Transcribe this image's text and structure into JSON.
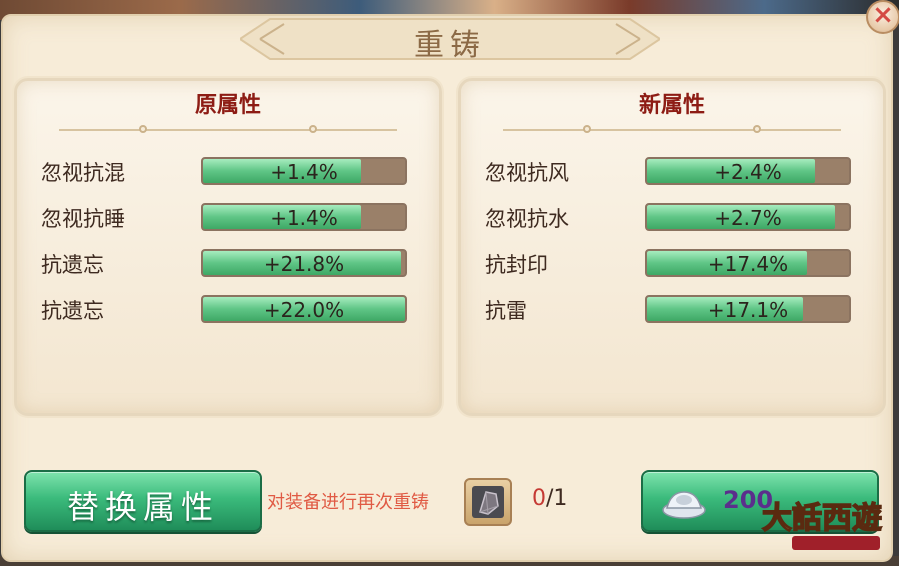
{
  "dialog": {
    "title": "重铸",
    "close_label": "×"
  },
  "original_panel": {
    "title": "原属性",
    "attributes": [
      {
        "name": "忽视抗混",
        "value": "+1.4%",
        "fill": 0.78
      },
      {
        "name": "忽视抗睡",
        "value": "+1.4%",
        "fill": 0.78
      },
      {
        "name": "抗遗忘",
        "value": "+21.8%",
        "fill": 0.98
      },
      {
        "name": "抗遗忘",
        "value": "+22.0%",
        "fill": 1.0
      }
    ]
  },
  "new_panel": {
    "title": "新属性",
    "attributes": [
      {
        "name": "忽视抗风",
        "value": "+2.4%",
        "fill": 0.83
      },
      {
        "name": "忽视抗水",
        "value": "+2.7%",
        "fill": 0.93
      },
      {
        "name": "抗封印",
        "value": "+17.4%",
        "fill": 0.79
      },
      {
        "name": "抗雷",
        "value": "+17.1%",
        "fill": 0.77
      }
    ]
  },
  "footer": {
    "replace_button": "替换属性",
    "hint": "对装备进行再次重铸",
    "material_current": "0",
    "material_max": "/1",
    "cost": "200",
    "cost_icon": "silver-ingot-icon"
  },
  "watermark": {
    "text": "大话西游"
  },
  "colors": {
    "bar_fill": "#5fc586",
    "bar_empty": "#9a8069",
    "title_red": "#8d1c14",
    "button_green": "#3bbb7c"
  }
}
